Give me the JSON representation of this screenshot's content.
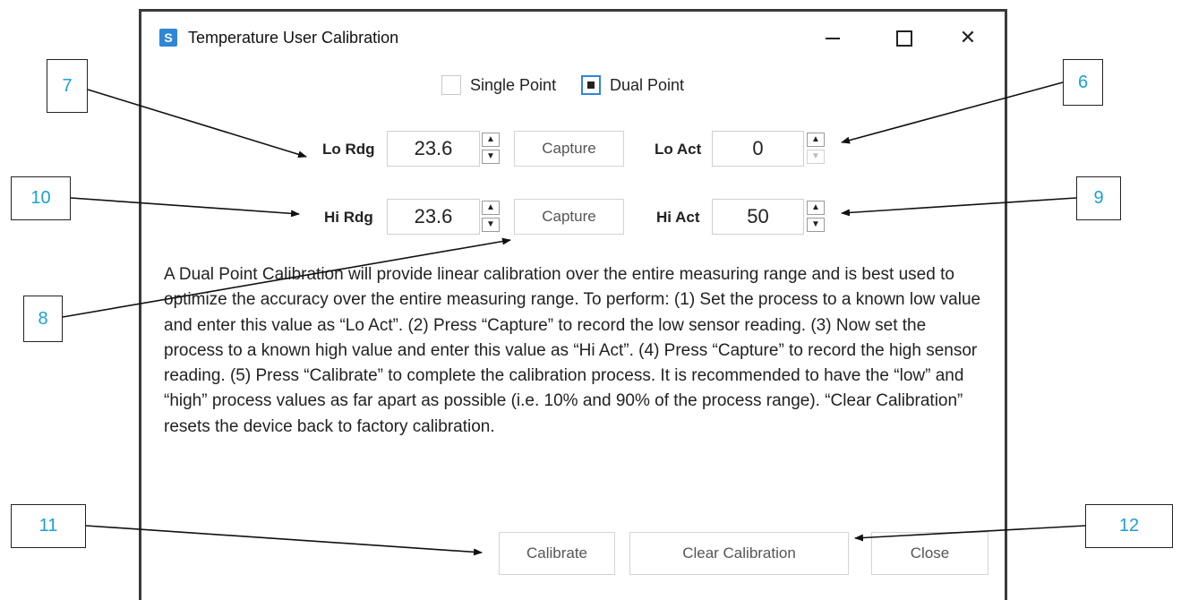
{
  "window": {
    "title": "Temperature User Calibration",
    "app_icon": "S",
    "controls": {
      "minimize": "—",
      "maximize": "",
      "close": "✕"
    }
  },
  "mode": {
    "single_label": "Single Point",
    "dual_label": "Dual Point",
    "selected": "Dual Point"
  },
  "lo": {
    "rdg_label": "Lo Rdg",
    "rdg_value": "23.6",
    "capture_label": "Capture",
    "act_label": "Lo Act",
    "act_value": "0"
  },
  "hi": {
    "rdg_label": "Hi Rdg",
    "rdg_value": "23.6",
    "capture_label": "Capture",
    "act_label": "Hi Act",
    "act_value": "50"
  },
  "description": "A Dual Point Calibration will provide linear calibration over the entire measuring range and is best used to optimize the accuracy over the entire measuring range. To perform: (1) Set the process to a known low value and enter this value as “Lo Act”. (2) Press “Capture” to record the low sensor reading. (3) Now set the process to a known high value and enter this value as “Hi Act”. (4) Press “Capture” to record the high sensor reading. (5) Press “Calibrate” to complete the calibration process. It is recommended to have the “low” and “high” process values as far apart as possible (i.e. 10% and 90% of the process range). “Clear Calibration” resets the device back to factory calibration.",
  "buttons": {
    "calibrate": "Calibrate",
    "clear_calibration": "Clear Calibration",
    "close": "Close"
  },
  "callouts": {
    "c6": "6",
    "c7": "7",
    "c8": "8",
    "c9": "9",
    "c10": "10",
    "c11": "11",
    "c12": "12"
  },
  "colors": {
    "callout_text": "#1aa0d8",
    "accent": "#2f86d6"
  }
}
